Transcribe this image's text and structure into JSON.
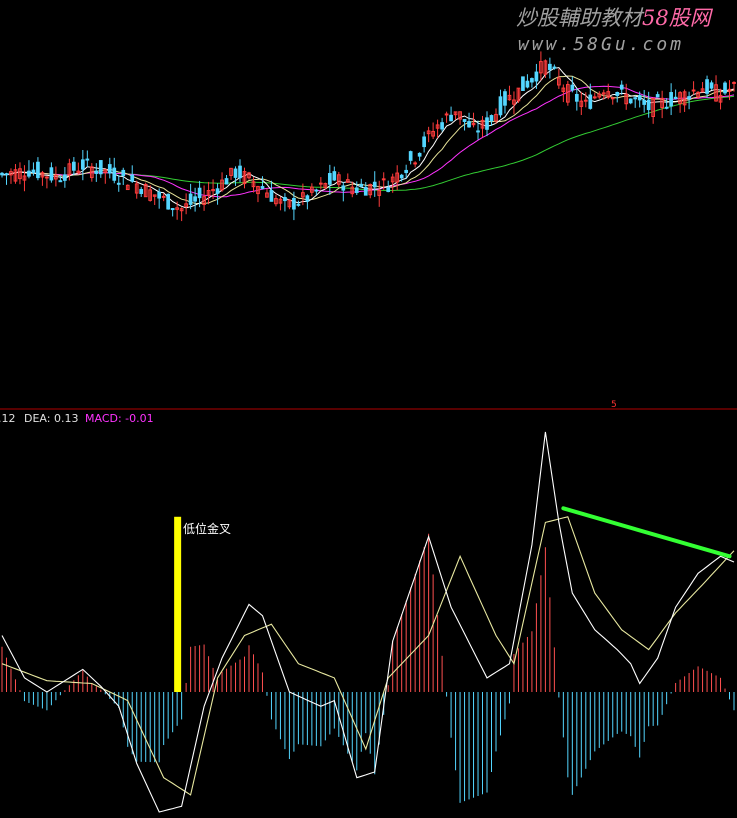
{
  "watermark": {
    "line1_cn": "炒股輔助教材",
    "line1_brand": "58股网",
    "line2": "www.58Gu.com"
  },
  "macd_header": {
    "dif_text": ".12",
    "dea_text": "DEA: 0.13",
    "macd_text": "MACD: -0.01",
    "marker": "5"
  },
  "annotation": {
    "text": "低位金叉"
  },
  "colors": {
    "background": "#000000",
    "up_candle": "#ff3c3c",
    "down_candle": "#54d6ff",
    "ma_fast": "#ffffff",
    "ma_mid": "#e7e39a",
    "ma_slow": "#ff33ff",
    "ma_long": "#33cc33",
    "pane_divider": "#b00000",
    "macd_pos": "#ff5050",
    "macd_neg": "#54d6ff",
    "dif_line": "#ffffff",
    "dea_line": "#e8e8a0",
    "highlight_bar": "#ffff00",
    "trend_line": "#33ff33",
    "watermark": "#9a9a9a",
    "dea_label": "#e0e0e0",
    "macd_label": "#ff33ff",
    "marker": "#ff3333"
  },
  "chart_data": [
    {
      "type": "candlestick",
      "title": "",
      "num_bars": 164,
      "y_range": [
        0,
        100
      ],
      "close_path": [
        [
          0,
          48
        ],
        [
          6,
          50
        ],
        [
          12,
          47
        ],
        [
          18,
          52
        ],
        [
          24,
          49
        ],
        [
          30,
          44
        ],
        [
          36,
          37
        ],
        [
          40,
          33
        ],
        [
          46,
          40
        ],
        [
          52,
          49
        ],
        [
          57,
          44
        ],
        [
          63,
          34
        ],
        [
          68,
          38
        ],
        [
          74,
          46
        ],
        [
          79,
          42
        ],
        [
          86,
          44
        ],
        [
          92,
          56
        ],
        [
          96,
          67
        ],
        [
          101,
          76
        ],
        [
          105,
          67
        ],
        [
          108,
          70
        ],
        [
          112,
          80
        ],
        [
          116,
          86
        ],
        [
          121,
          96
        ],
        [
          126,
          84
        ],
        [
          130,
          78
        ],
        [
          134,
          86
        ],
        [
          139,
          82
        ],
        [
          144,
          77
        ],
        [
          151,
          82
        ],
        [
          156,
          86
        ],
        [
          160,
          83
        ],
        [
          163,
          86
        ]
      ],
      "ma_fast_period": 5,
      "ma_mid_period": 10,
      "ma_slow_period": 20,
      "ma_long_period": 60,
      "ma_long_start": 48
    },
    {
      "type": "macd",
      "zero": 0,
      "y_range": [
        -42,
        92
      ],
      "dif_points": [
        [
          0,
          20
        ],
        [
          5,
          5
        ],
        [
          10,
          0
        ],
        [
          18,
          8
        ],
        [
          22,
          2
        ],
        [
          26,
          -5
        ],
        [
          30,
          -25
        ],
        [
          35,
          -42
        ],
        [
          40,
          -40
        ],
        [
          45,
          -5
        ],
        [
          49,
          12
        ],
        [
          55,
          31
        ],
        [
          58,
          27
        ],
        [
          64,
          0
        ],
        [
          71,
          -5
        ],
        [
          74,
          -3
        ],
        [
          79,
          -30
        ],
        [
          83,
          -28
        ],
        [
          87,
          18
        ],
        [
          95,
          55
        ],
        [
          100,
          30
        ],
        [
          108,
          5
        ],
        [
          113,
          10
        ],
        [
          118,
          52
        ],
        [
          121,
          92
        ],
        [
          124,
          60
        ],
        [
          127,
          35
        ],
        [
          132,
          22
        ],
        [
          137,
          15
        ],
        [
          140,
          10
        ],
        [
          142,
          3
        ],
        [
          146,
          12
        ],
        [
          150,
          30
        ],
        [
          155,
          42
        ],
        [
          160,
          48
        ],
        [
          163,
          46
        ]
      ],
      "dea_points": [
        [
          0,
          10
        ],
        [
          10,
          4
        ],
        [
          20,
          3
        ],
        [
          28,
          -3
        ],
        [
          36,
          -30
        ],
        [
          42,
          -36
        ],
        [
          48,
          5
        ],
        [
          54,
          20
        ],
        [
          60,
          24
        ],
        [
          66,
          10
        ],
        [
          74,
          5
        ],
        [
          81,
          -20
        ],
        [
          86,
          5
        ],
        [
          95,
          20
        ],
        [
          102,
          48
        ],
        [
          110,
          20
        ],
        [
          114,
          10
        ],
        [
          121,
          60
        ],
        [
          126,
          62
        ],
        [
          132,
          35
        ],
        [
          138,
          22
        ],
        [
          144,
          15
        ],
        [
          150,
          28
        ],
        [
          156,
          38
        ],
        [
          163,
          50
        ]
      ],
      "highlight_bar_index": 39,
      "trend_line": [
        [
          125,
          65
        ],
        [
          162,
          48
        ]
      ]
    }
  ]
}
